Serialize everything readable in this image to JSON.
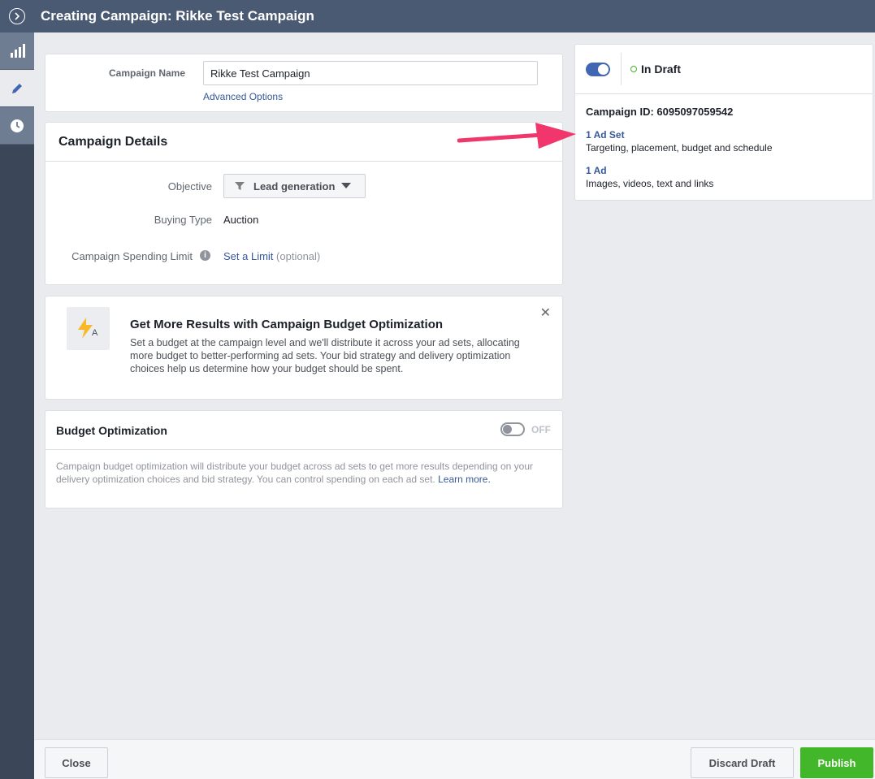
{
  "header": {
    "title": "Creating Campaign: Rikke Test Campaign"
  },
  "sidenav": {
    "items": [
      {
        "icon": "bar-chart-icon"
      },
      {
        "icon": "pencil-icon"
      },
      {
        "icon": "clock-icon"
      }
    ]
  },
  "campaign_name": {
    "label": "Campaign Name",
    "value": "Rikke Test Campaign",
    "advanced_link": "Advanced Options"
  },
  "details": {
    "title": "Campaign Details",
    "objective_label": "Objective",
    "objective_value": "Lead generation",
    "buying_type_label": "Buying Type",
    "buying_type_value": "Auction",
    "spending_limit_label": "Campaign Spending Limit",
    "spending_limit_link": "Set a Limit",
    "spending_limit_note": "(optional)"
  },
  "cbo_promo": {
    "title": "Get More Results with Campaign Budget Optimization",
    "body": "Set a budget at the campaign level and we'll distribute it across your ad sets, allocating more budget to better-performing ad sets. Your bid strategy and delivery optimization choices help us determine how your budget should be spent.",
    "icon_letter": "A"
  },
  "budget_optimization": {
    "title": "Budget Optimization",
    "toggle_label": "OFF",
    "description": "Campaign budget optimization will distribute your budget across ad sets to get more results depending on your delivery optimization choices and bid strategy. You can control spending on each ad set.",
    "learn_more": "Learn more."
  },
  "status_panel": {
    "status": "In Draft",
    "campaign_id": "Campaign ID: 6095097059542",
    "ad_set_link": "1 Ad Set",
    "ad_set_desc": "Targeting, placement, budget and schedule",
    "ad_link": "1 Ad",
    "ad_desc": "Images, videos, text and links"
  },
  "footer": {
    "close": "Close",
    "discard": "Discard Draft",
    "publish": "Publish"
  },
  "colors": {
    "header": "#4b5a73",
    "link": "#365899",
    "publish": "#42b72a",
    "arrow": "#f0366b",
    "toggle_on": "#4267b2"
  }
}
